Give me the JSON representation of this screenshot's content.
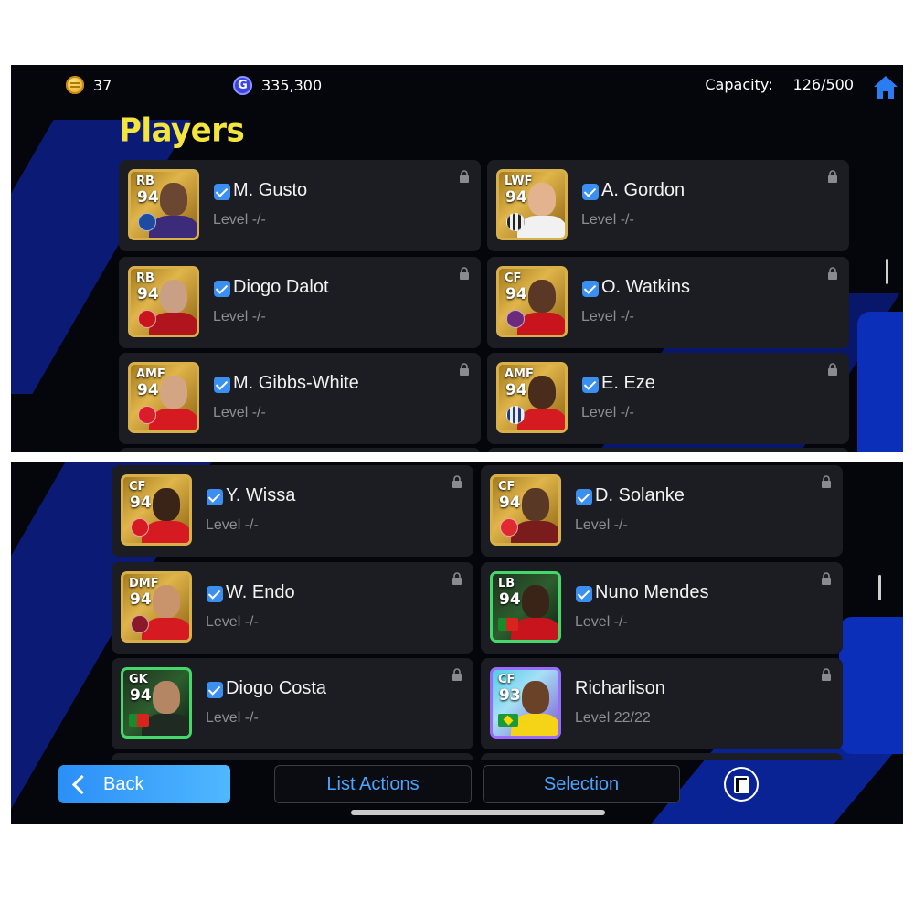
{
  "status": {
    "coins": "37",
    "gp": "335,300",
    "gp_symbol": "G",
    "capacity_label": "Capacity:",
    "capacity_value": "126/500"
  },
  "title": "Players",
  "top_cards": [
    {
      "pos": "RB",
      "rating": "94",
      "name": "M. Gusto",
      "level": "Level -/-"
    },
    {
      "pos": "LWF",
      "rating": "94",
      "name": "A. Gordon",
      "level": "Level -/-"
    },
    {
      "pos": "RB",
      "rating": "94",
      "name": "Diogo Dalot",
      "level": "Level -/-"
    },
    {
      "pos": "CF",
      "rating": "94",
      "name": "O. Watkins",
      "level": "Level -/-"
    },
    {
      "pos": "AMF",
      "rating": "94",
      "name": "M. Gibbs-White",
      "level": "Level -/-"
    },
    {
      "pos": "AMF",
      "rating": "94",
      "name": "E. Eze",
      "level": "Level -/-"
    }
  ],
  "bottom_cards": [
    {
      "pos": "CF",
      "rating": "94",
      "name": "Y. Wissa",
      "level": "Level -/-"
    },
    {
      "pos": "CF",
      "rating": "94",
      "name": "D. Solanke",
      "level": "Level -/-"
    },
    {
      "pos": "DMF",
      "rating": "94",
      "name": "W. Endo",
      "level": "Level -/-"
    },
    {
      "pos": "LB",
      "rating": "94",
      "name": "Nuno Mendes",
      "level": "Level -/-"
    },
    {
      "pos": "GK",
      "rating": "94",
      "name": "Diogo Costa",
      "level": "Level -/-"
    },
    {
      "pos": "CF",
      "rating": "93",
      "name": "Richarlison",
      "level": "Level 22/22"
    }
  ],
  "actions": {
    "back": "Back",
    "list_actions": "List Actions",
    "selection": "Selection"
  },
  "icons": {
    "coin": "coin-icon",
    "gp": "gp-icon",
    "home": "home-icon",
    "lock": "lock-icon",
    "check": "checkmark-icon",
    "copy": "copy-icon"
  },
  "colors": {
    "title": "#f3e53c",
    "card_bg": "#1c1d22",
    "accent_blue": "#3a8ff0",
    "gold_border": "#d7b04a",
    "green_border": "#44d86b",
    "purple_border": "#9a6bff"
  }
}
